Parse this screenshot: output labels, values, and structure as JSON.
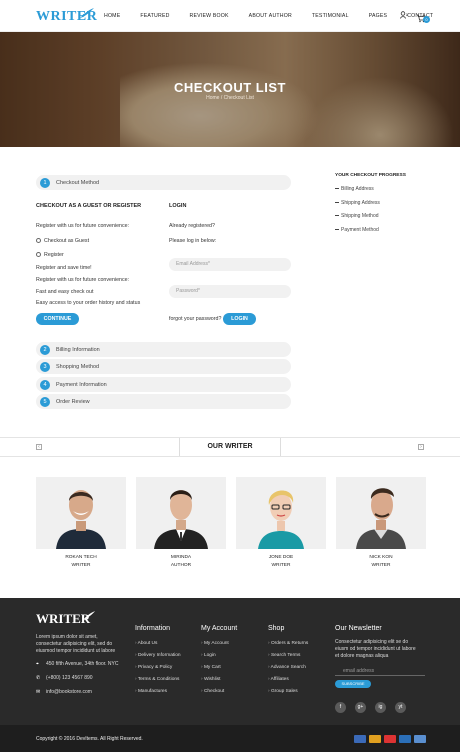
{
  "header": {
    "logo": "WRITER",
    "nav": [
      "HOME",
      "FEATURED",
      "REVIEW BOOK",
      "ABOUT AUTHOR",
      "TESTIMONIAL",
      "PAGES",
      "CONTACT"
    ],
    "cart_count": "0",
    "icons": [
      "user-icon",
      "cart-icon"
    ]
  },
  "hero": {
    "title": "CHECKOUT LIST",
    "breadcrumb": "Home / Checkout List"
  },
  "checkout": {
    "step1": {
      "num": "1",
      "label": "Checkout Method"
    },
    "guest": {
      "title": "CHECKOUT AS A GUEST OR REGISTER",
      "intro": "Register with us for future convenience:",
      "options": [
        "Checkout as Guest",
        "Register"
      ],
      "lines": [
        "Register and save time!",
        "Register with us for future convenience:",
        "Fast and easy check out",
        "Easy access to your order history and status"
      ],
      "button": "CONTINUE"
    },
    "login": {
      "title": "LOGIN",
      "registered": "Already registered?",
      "prompt": "Please log in below:",
      "email_placeholder": "Email Address*",
      "password_placeholder": "Password*",
      "forgot": "forgot your password?",
      "button": "LOGIN"
    },
    "steps": [
      {
        "num": "2",
        "label": "Billing Information"
      },
      {
        "num": "3",
        "label": "Shopping Method"
      },
      {
        "num": "4",
        "label": "Payment Information"
      },
      {
        "num": "5",
        "label": "Order Review"
      }
    ]
  },
  "progress": {
    "title": "YOUR CHECKOUT PROGRESS",
    "items": [
      "Billing Address",
      "Shipping Address",
      "Shipping Method",
      "Payment Method"
    ]
  },
  "writers": {
    "title": "OUR WRITER",
    "people": [
      {
        "name": "ROKAN TECH",
        "role": "WRITER"
      },
      {
        "name": "MIRINDA",
        "role": "AUTHOR"
      },
      {
        "name": "JONE DOE",
        "role": "WRITER"
      },
      {
        "name": "NICK KON",
        "role": "WRITER"
      }
    ]
  },
  "footer": {
    "logo": "WRITER",
    "about": [
      "Lorem ipsum dolor sit amet,",
      "consectetur adipisicing elit, sed do",
      "eiusmod tempor incididunt ut labore"
    ],
    "address": "450 fifth Avenue, 34th floor. NYC",
    "phone": "(+800) 123 4567 890",
    "email": "info@bookstore.com",
    "information": {
      "title": "Information",
      "links": [
        "About Us",
        "Delivery Information",
        "Privacy & Policy",
        "Terms & Conditions",
        "Manufactures"
      ]
    },
    "account": {
      "title": "My Account",
      "links": [
        "My Account",
        "Login",
        "My Cart",
        "Wishlist",
        "Checkout"
      ]
    },
    "shop": {
      "title": "Shop",
      "links": [
        "Orders & Returns",
        "Search Terms",
        "Advance Search",
        "Affiliates",
        "Group Sales"
      ]
    },
    "newsletter": {
      "title": "Our Newsletter",
      "text": [
        "Consectetur adipisicing elit se do",
        "eiusm od tempor incididunt ut labore",
        "et dolore magnas aliqua"
      ],
      "placeholder": "email address",
      "button": "SUBSCRIBE"
    },
    "social": [
      "f",
      "g+",
      "ig",
      "yt"
    ],
    "copyright": "Copyright © 2016 DevItems. All Right Reserved.",
    "payment_colors": [
      "#3b6ab8",
      "#e0a020",
      "#d33",
      "#2b6fb8",
      "#5a8fd0"
    ]
  },
  "colors": {
    "accent": "#2b9bd6"
  }
}
